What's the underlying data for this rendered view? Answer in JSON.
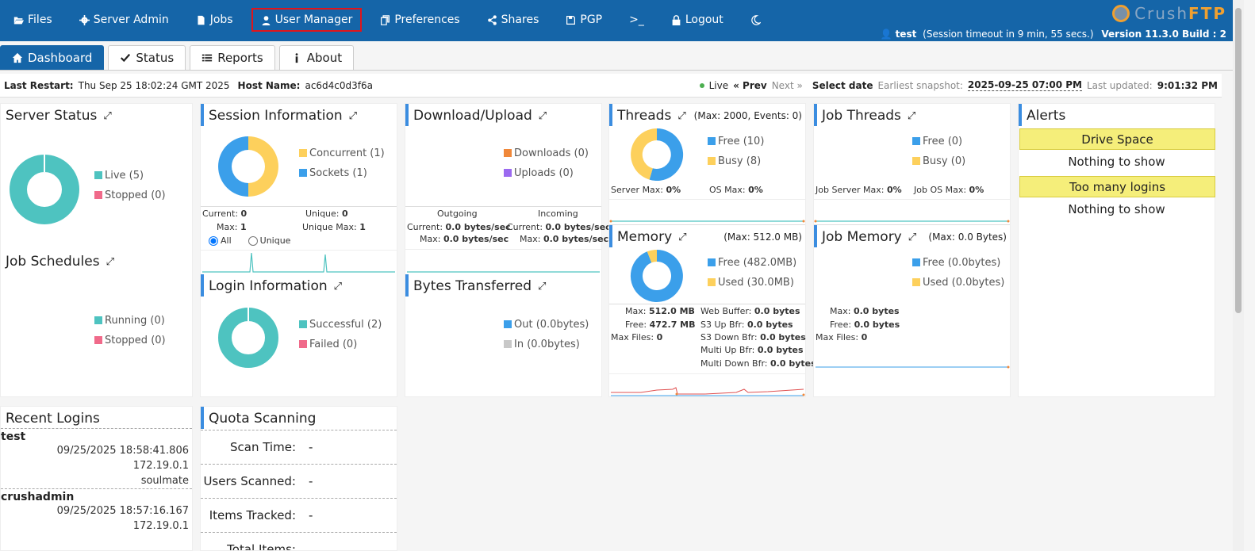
{
  "nav": {
    "items": [
      {
        "label": "Files",
        "icon": "folder-open-icon"
      },
      {
        "label": "Server Admin",
        "icon": "gear-icon"
      },
      {
        "label": "Jobs",
        "icon": "document-icon"
      },
      {
        "label": "User Manager",
        "icon": "user-icon"
      },
      {
        "label": "Preferences",
        "icon": "copy-icon"
      },
      {
        "label": "Shares",
        "icon": "share-icon"
      },
      {
        "label": "PGP",
        "icon": "save-icon"
      },
      {
        "label": ">_",
        "icon": "terminal-icon"
      },
      {
        "label": "Logout",
        "icon": "lock-icon"
      },
      {
        "label": "",
        "icon": "moon-icon"
      }
    ],
    "highlight_color": "#e0151b"
  },
  "brand": {
    "part1": "Crush",
    "part2": "FTP"
  },
  "userline": {
    "user": "test",
    "session": "(Session timeout in 9 min, 55 secs.)",
    "version": "Version 11.3.0 Build : 2"
  },
  "tabs": [
    {
      "label": "Dashboard",
      "icon": "home-icon"
    },
    {
      "label": "Status",
      "icon": "check-icon"
    },
    {
      "label": "Reports",
      "icon": "list-icon"
    },
    {
      "label": "About",
      "icon": "info-icon"
    }
  ],
  "statusbar": {
    "last_restart_label": "Last Restart:",
    "last_restart": "Thu Sep 25 18:02:24 GMT 2025",
    "host_label": "Host Name:",
    "host": "ac6d4c0d3f6a",
    "live": "Live",
    "prev": "« Prev",
    "next": "Next »",
    "select_date": "Select date",
    "earliest_label": "Earliest snapshot:",
    "earliest": "2025-09-25 07:00 PM",
    "updated_label": "Last updated:",
    "updated": "9:01:32 PM"
  },
  "colors": {
    "brand": "#1565a8",
    "teal": "#4ec3c0",
    "blue": "#3b9fea",
    "yellow": "#fdd05c",
    "pink": "#f06a8a",
    "orange": "#f0883a",
    "purple": "#9b6af0",
    "grey": "#c8c8c8"
  },
  "server_status": {
    "title": "Server Status",
    "legend": [
      "Live (5)",
      "Stopped (0)"
    ],
    "values": [
      5,
      0
    ]
  },
  "job_schedules": {
    "title": "Job Schedules",
    "legend": [
      "Running (0)",
      "Stopped (0)"
    ]
  },
  "session": {
    "title": "Session Information",
    "legend": [
      "Concurrent (1)",
      "Sockets (1)"
    ],
    "values": [
      1,
      1
    ],
    "current_label": "Current:",
    "current": "0",
    "unique_label": "Unique:",
    "unique": "0",
    "max_label": "Max:",
    "max": "1",
    "unique_max_label": "Unique Max:",
    "unique_max": "1",
    "radio_all": "All",
    "radio_unique": "Unique"
  },
  "login": {
    "title": "Login Information",
    "legend": [
      "Successful (2)",
      "Failed (0)"
    ],
    "values": [
      2,
      0
    ]
  },
  "download": {
    "title": "Download/Upload",
    "legend": [
      "Downloads (0)",
      "Uploads (0)"
    ],
    "outgoing": "Outgoing",
    "incoming": "Incoming",
    "current_label": "Current:",
    "max_label": "Max:",
    "out_current": "0.0 bytes/sec",
    "out_max": "0.0 bytes/sec",
    "in_current": "0.0 bytes/sec",
    "in_max": "0.0 bytes/sec"
  },
  "bytes": {
    "title": "Bytes Transferred",
    "legend": [
      "Out (0.0bytes)",
      "In (0.0bytes)"
    ]
  },
  "threads": {
    "title": "Threads",
    "extra": "(Max: 2000, Events: 0)",
    "legend": [
      "Free (10)",
      "Busy (8)"
    ],
    "values": [
      10,
      8
    ],
    "server_max_label": "Server Max:",
    "server_max": "0%",
    "os_max_label": "OS Max:",
    "os_max": "0%"
  },
  "job_threads": {
    "title": "Job Threads",
    "legend": [
      "Free (0)",
      "Busy (0)"
    ],
    "server_max_label": "Job Server Max:",
    "server_max": "0%",
    "os_max_label": "Job OS Max:",
    "os_max": "0%"
  },
  "memory": {
    "title": "Memory",
    "extra": "(Max: 512.0 MB)",
    "legend": [
      "Free (482.0MB)",
      "Used (30.0MB)"
    ],
    "values": [
      482,
      30
    ],
    "max_label": "Max:",
    "max": "512.0 MB",
    "free_label": "Free:",
    "free": "472.7 MB",
    "files_label": "Max Files:",
    "files": "0",
    "web_label": "Web Buffer:",
    "web": "0.0 bytes",
    "s3up_label": "S3 Up Bfr:",
    "s3up": "0.0 bytes",
    "s3down_label": "S3 Down Bfr:",
    "s3down": "0.0 bytes",
    "mup_label": "Multi Up Bfr:",
    "mup": "0.0 bytes",
    "mdown_label": "Multi Down Bfr:",
    "mdown": "0.0 bytes"
  },
  "job_memory": {
    "title": "Job Memory",
    "extra": "(Max: 0.0 Bytes)",
    "legend": [
      "Free (0.0bytes)",
      "Used (0.0bytes)"
    ],
    "max_label": "Max:",
    "max": "0.0 bytes",
    "free_label": "Free:",
    "free": "0.0 bytes",
    "files_label": "Max Files:",
    "files": "0"
  },
  "alerts": {
    "title": "Alerts",
    "sections": [
      {
        "label": "Drive Space",
        "text": "Nothing to show"
      },
      {
        "label": "Too many logins",
        "text": "Nothing to show"
      }
    ]
  },
  "recent_logins": {
    "title": "Recent Logins",
    "entries": [
      {
        "user": "test",
        "time": "09/25/2025 18:58:41.806",
        "ip": "172.19.0.1",
        "agent": "soulmate"
      },
      {
        "user": "crushadmin",
        "time": "09/25/2025 18:57:16.167",
        "ip": "172.19.0.1"
      }
    ]
  },
  "quota": {
    "title": "Quota Scanning",
    "rows": [
      {
        "label": "Scan Time:",
        "value": "-"
      },
      {
        "label": "Users Scanned:",
        "value": "-"
      },
      {
        "label": "Items Tracked:",
        "value": "-"
      },
      {
        "label": "Total Items:",
        "value": ""
      }
    ]
  }
}
